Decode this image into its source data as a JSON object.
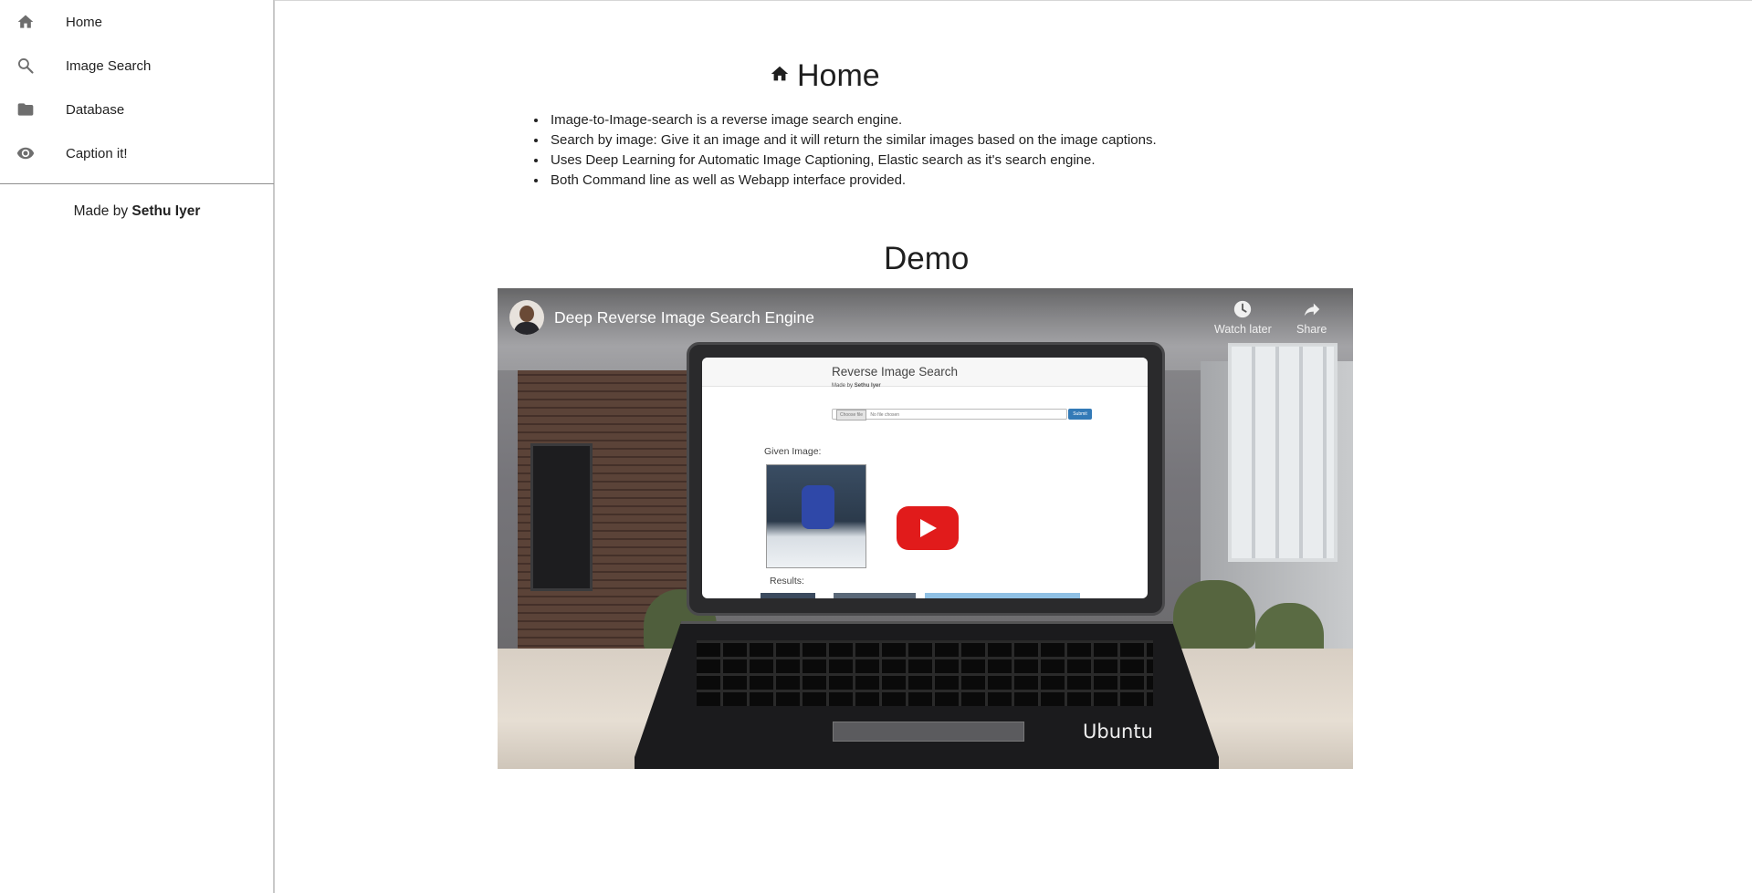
{
  "sidebar": {
    "items": [
      {
        "label": "Home",
        "icon": "home-icon"
      },
      {
        "label": "Image Search",
        "icon": "search-icon"
      },
      {
        "label": "Database",
        "icon": "folder-icon"
      },
      {
        "label": "Caption it!",
        "icon": "eye-icon"
      }
    ],
    "credit_prefix": "Made by",
    "credit_name": "Sethu Iyer"
  },
  "main": {
    "title": "Home",
    "title_icon": "home-icon",
    "bullets": [
      "Image-to-Image-search is a reverse image search engine.",
      "Search by image: Give it an image and it will return the similar images based on the image captions.",
      "Uses Deep Learning for Automatic Image Captioning, Elastic search as it's search engine.",
      "Both Command line as well as Webapp interface provided."
    ],
    "demo_title": "Demo"
  },
  "video": {
    "title": "Deep Reverse Image Search Engine",
    "watch_later": "Watch later",
    "share": "Share",
    "screen": {
      "title": "Reverse Image Search",
      "subtitle_prefix": "Made by",
      "subtitle_name": "Sethu Iyer",
      "choose_file": "Choose file",
      "no_file": "No file chosen",
      "submit": "Submit",
      "given_image": "Given Image:",
      "results": "Results:"
    },
    "laptop_brand": "Ubuntu"
  },
  "colors": {
    "play_button": "#e11b1b",
    "sidebar_icon": "#6e6e6e",
    "divider": "#8f8f8f"
  }
}
